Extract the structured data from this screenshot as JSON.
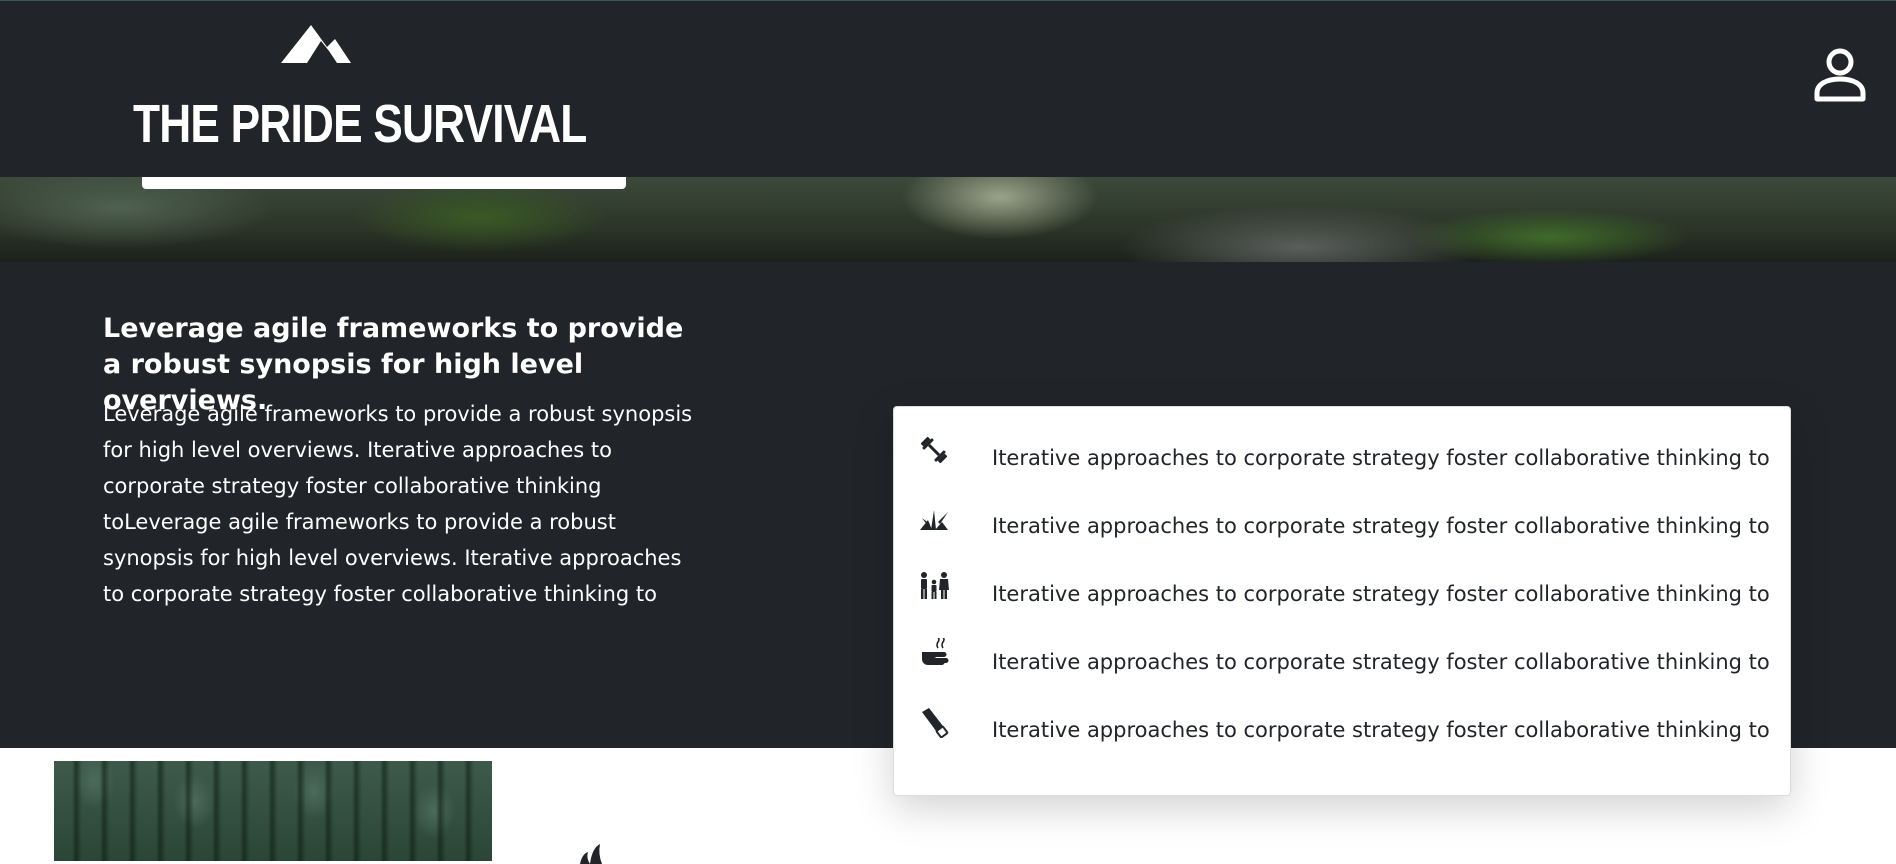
{
  "header": {
    "logo_icon": "mountain-icon",
    "brand_title": "THE PRIDE SURVIVAL",
    "user_icon": "user-account-icon"
  },
  "intro": {
    "heading": "Leverage agile frameworks to provide a robust synopsis for high level overviews.",
    "text": "Leverage agile frameworks to provide a robust synopsis for high level overviews. Iterative approaches to corporate strategy foster collaborative thinking toLeverage agile frameworks to provide a robust synopsis for high level overviews. Iterative approaches to corporate strategy foster collaborative thinking to"
  },
  "features": {
    "items": [
      {
        "icon": "dumbbell-icon",
        "text": "Iterative approaches to corporate strategy foster collaborative thinking to"
      },
      {
        "icon": "grass-sprout-icon",
        "text": "Iterative approaches to corporate strategy foster collaborative thinking to"
      },
      {
        "icon": "family-icon",
        "text": "Iterative approaches to corporate strategy foster collaborative thinking to"
      },
      {
        "icon": "hand-wash-icon",
        "text": "Iterative approaches to corporate strategy foster collaborative thinking to"
      },
      {
        "icon": "hacksaw-icon",
        "text": "Iterative approaches to corporate strategy foster collaborative thinking to"
      }
    ]
  },
  "colors": {
    "dark_background": "#212429",
    "card_text": "#212429",
    "light_text": "#ffffff"
  }
}
